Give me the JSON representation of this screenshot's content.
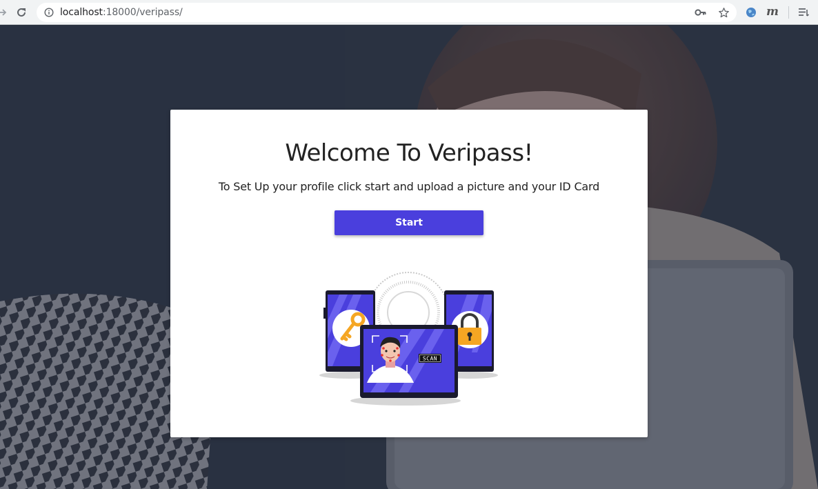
{
  "browser": {
    "url_host": "localhost",
    "url_path": ":18000/veripass/"
  },
  "card": {
    "title": "Welcome To Veripass!",
    "subtitle": "To Set Up your profile click start and upload a picture and your ID Card",
    "start_label": "Start",
    "scan_label": "SCAN"
  },
  "colors": {
    "accent": "#4a3fdd",
    "key": "#f5a623",
    "lock": "#f5a623"
  }
}
